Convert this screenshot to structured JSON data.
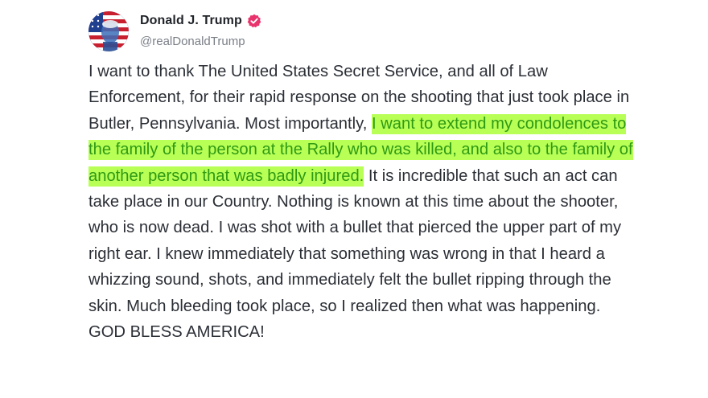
{
  "post": {
    "author": {
      "display_name": "Donald J. Trump",
      "handle": "@realDonaldTrump",
      "verified": true,
      "verified_badge_color": "#e8336d"
    },
    "text": {
      "before_highlight": "I want to thank The United States Secret Service, and all of Law Enforcement, for their rapid response on the shooting that just took place in Butler, Pennsylvania. Most importantly, ",
      "highlight": "I want to extend my condolences to the family of the person at the Rally who was killed, and also to the family of another person that was badly injured.",
      "after_highlight": " It is incredible that such an act can take place in our Country. Nothing is known at this time about the shooter, who is now dead. I was shot with a bullet that pierced the upper part of my right ear. I knew immediately that something was wrong in that I heard a whizzing sound, shots, and immediately felt the bullet ripping through the skin. Much bleeding took place, so I realized then what was happening. GOD BLESS AMERICA!"
    },
    "colors": {
      "highlight_background": "#b8ff56",
      "highlight_text": "#2f9a14",
      "body_text": "#2b2f36",
      "handle_text": "#7b8088"
    }
  }
}
